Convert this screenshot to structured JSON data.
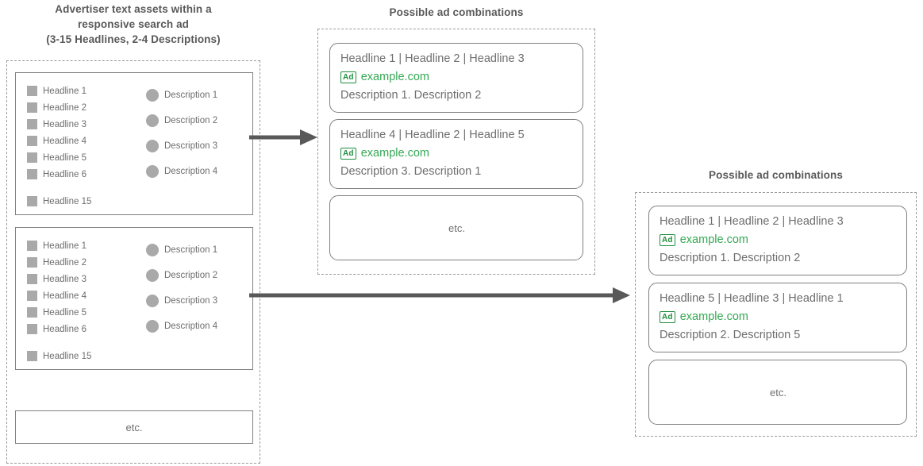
{
  "titles": {
    "left": "Advertiser text assets within a responsive search ad (3-15 Headlines, 2-4 Descriptions)",
    "left_line1": "Advertiser text assets within a",
    "left_line2": "responsive search ad",
    "left_line3": "(3-15 Headlines, 2-4 Descriptions)",
    "middle": "Possible ad combinations",
    "right": "Possible ad combinations"
  },
  "colors": {
    "text_gray": "#6e6e6e",
    "title_gray": "#595959",
    "swatch_gray": "#a9a9a9",
    "border_gray": "#808080",
    "dashed_gray": "#9a9a9a",
    "ad_badge_green": "#1e8e3e",
    "ad_url_green": "#34a853",
    "arrow_gray": "#595959"
  },
  "asset_groups": [
    {
      "headlines": [
        {
          "label": "Headline 1",
          "icon": "square-swatch-icon",
          "gap_before": false
        },
        {
          "label": "Headline 2",
          "icon": "square-swatch-icon",
          "gap_before": false
        },
        {
          "label": "Headline 3",
          "icon": "square-swatch-icon",
          "gap_before": false
        },
        {
          "label": "Headline 4",
          "icon": "square-swatch-icon",
          "gap_before": false
        },
        {
          "label": "Headline 5",
          "icon": "square-swatch-icon",
          "gap_before": false
        },
        {
          "label": "Headline 6",
          "icon": "square-swatch-icon",
          "gap_before": false
        },
        {
          "label": "Headline 15",
          "icon": "square-swatch-icon",
          "gap_before": true
        }
      ],
      "descriptions": [
        {
          "label": "Description 1",
          "icon": "circle-swatch-icon"
        },
        {
          "label": "Description 2",
          "icon": "circle-swatch-icon"
        },
        {
          "label": "Description 3",
          "icon": "circle-swatch-icon"
        },
        {
          "label": "Description 4",
          "icon": "circle-swatch-icon"
        }
      ]
    },
    {
      "headlines": [
        {
          "label": "Headline 1",
          "icon": "square-swatch-icon",
          "gap_before": false
        },
        {
          "label": "Headline 2",
          "icon": "square-swatch-icon",
          "gap_before": false
        },
        {
          "label": "Headline 3",
          "icon": "square-swatch-icon",
          "gap_before": false
        },
        {
          "label": "Headline 4",
          "icon": "square-swatch-icon",
          "gap_before": false
        },
        {
          "label": "Headline 5",
          "icon": "square-swatch-icon",
          "gap_before": false
        },
        {
          "label": "Headline 6",
          "icon": "square-swatch-icon",
          "gap_before": false
        },
        {
          "label": "Headline 15",
          "icon": "square-swatch-icon",
          "gap_before": true
        }
      ],
      "descriptions": [
        {
          "label": "Description 1",
          "icon": "circle-swatch-icon"
        },
        {
          "label": "Description 2",
          "icon": "circle-swatch-icon"
        },
        {
          "label": "Description 3",
          "icon": "circle-swatch-icon"
        },
        {
          "label": "Description 4",
          "icon": "circle-swatch-icon"
        }
      ]
    }
  ],
  "etc_label": "etc.",
  "ad_badge_label": "Ad",
  "middle_ads": [
    {
      "headline_line": "Headline 1 | Headline 2 | Headline 3",
      "url": "example.com",
      "description_line": "Description 1. Description 2"
    },
    {
      "headline_line": "Headline 4 | Headline 2 | Headline 5",
      "url": "example.com",
      "description_line": "Description 3. Description 1"
    }
  ],
  "right_ads": [
    {
      "headline_line": "Headline 1 | Headline 2 | Headline 3",
      "url": "example.com",
      "description_line": "Description 1. Description 2"
    },
    {
      "headline_line": "Headline 5 | Headline 3 | Headline 1",
      "url": "example.com",
      "description_line": "Description 2. Description 5"
    }
  ],
  "arrows": [
    {
      "name": "arrow-group1-to-middle",
      "length": 80
    },
    {
      "name": "arrow-group2-to-right",
      "length": 478
    }
  ]
}
